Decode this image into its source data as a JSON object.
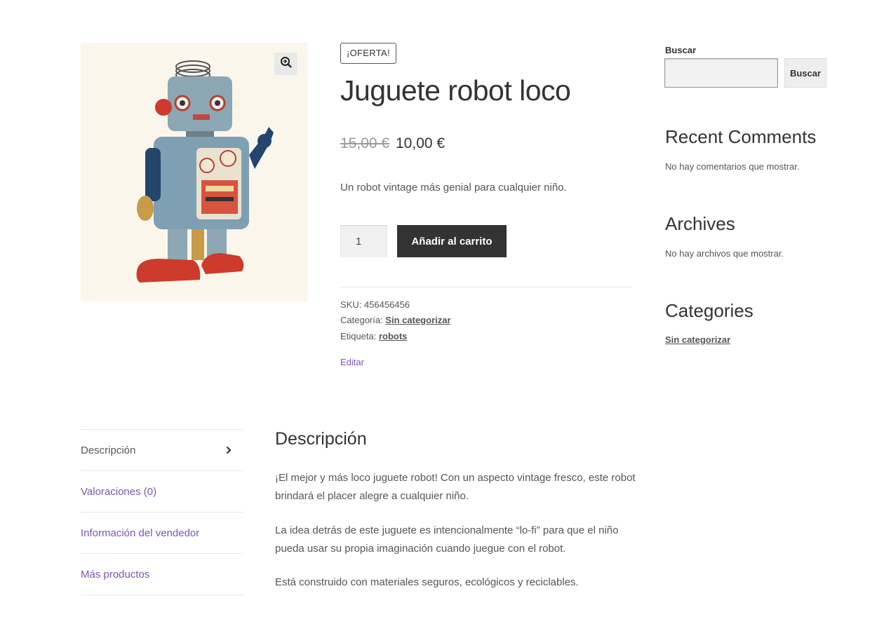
{
  "product": {
    "badge": "¡Oferta!",
    "title": "Juguete robot loco",
    "price_old": "15,00 €",
    "price_new": "10,00 €",
    "short_description": "Un robot vintage más genial para cualquier niño.",
    "quantity": "1",
    "add_to_cart_label": "Añadir al carrito",
    "sku_label": "SKU:",
    "sku_value": "456456456",
    "category_label": "Categoría:",
    "category_value": "Sin categorizar",
    "tag_label": "Etiqueta:",
    "tag_value": "robots",
    "edit_label": "Editar",
    "zoom_icon": "magnifier-plus-icon"
  },
  "sidebar": {
    "search_label": "Buscar",
    "search_placeholder": "",
    "search_button": "Buscar",
    "recent_comments_title": "Recent Comments",
    "recent_comments_text": "No hay comentarios que mostrar.",
    "archives_title": "Archives",
    "archives_text": "No hay archivos que mostrar.",
    "categories_title": "Categories",
    "categories_link": "Sin categorizar"
  },
  "tabs": [
    {
      "label": "Descripción",
      "active": true
    },
    {
      "label": "Valoraciones (0)",
      "active": false
    },
    {
      "label": "Información del vendedor",
      "active": false
    },
    {
      "label": "Más productos",
      "active": false
    }
  ],
  "description": {
    "title": "Descripción",
    "paragraphs": [
      "¡El mejor y más loco juguete robot! Con un aspecto vintage fresco, este robot brindará el placer alegre a cualquier niño.",
      "La idea detrás de este juguete es intencionalmente “lo-fi” para que el niño pueda usar su propia imaginación cuando juegue con el robot.",
      "Está construido con materiales seguros, ecológicos y reciclables."
    ]
  },
  "colors": {
    "accent_purple": "#7f54b3",
    "button_dark": "#333333",
    "text": "#6d6d6d"
  }
}
